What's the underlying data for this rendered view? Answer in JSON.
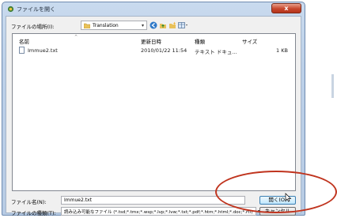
{
  "window": {
    "title": "ファイルを開く",
    "close_glyph": "x"
  },
  "lookin": {
    "label": "ファイルの場所(I):",
    "value": "Translation"
  },
  "toolbar": {
    "icons": [
      "back-icon",
      "up-folder-icon",
      "new-folder-icon",
      "view-menu-icon"
    ]
  },
  "list": {
    "columns": [
      "名前",
      "更新日時",
      "種類",
      "サイズ"
    ],
    "rows": [
      {
        "name": "Immue2.txt",
        "modified": "2010/01/22 11:54",
        "type": "テキスト ドキュ...",
        "size": "1 KB"
      }
    ]
  },
  "bottom": {
    "filename_label": "ファイル名(N):",
    "filename_value": "Immue2.txt",
    "filetype_label": "ファイルの種類(T):",
    "filetype_value": "読み込み可能なファイル (*.tsd;*.tmx;*.wsp;*.lvp;*.lvw;*.txt;*.pdf;*.htm;*.html;*.doc;*.rtf)",
    "open_label": "開く(O)",
    "cancel_label": "キャンセル"
  },
  "colors": {
    "annotation": "#c0341e",
    "close_button": "#c7472c",
    "window_frame": "#bcd0e8"
  }
}
